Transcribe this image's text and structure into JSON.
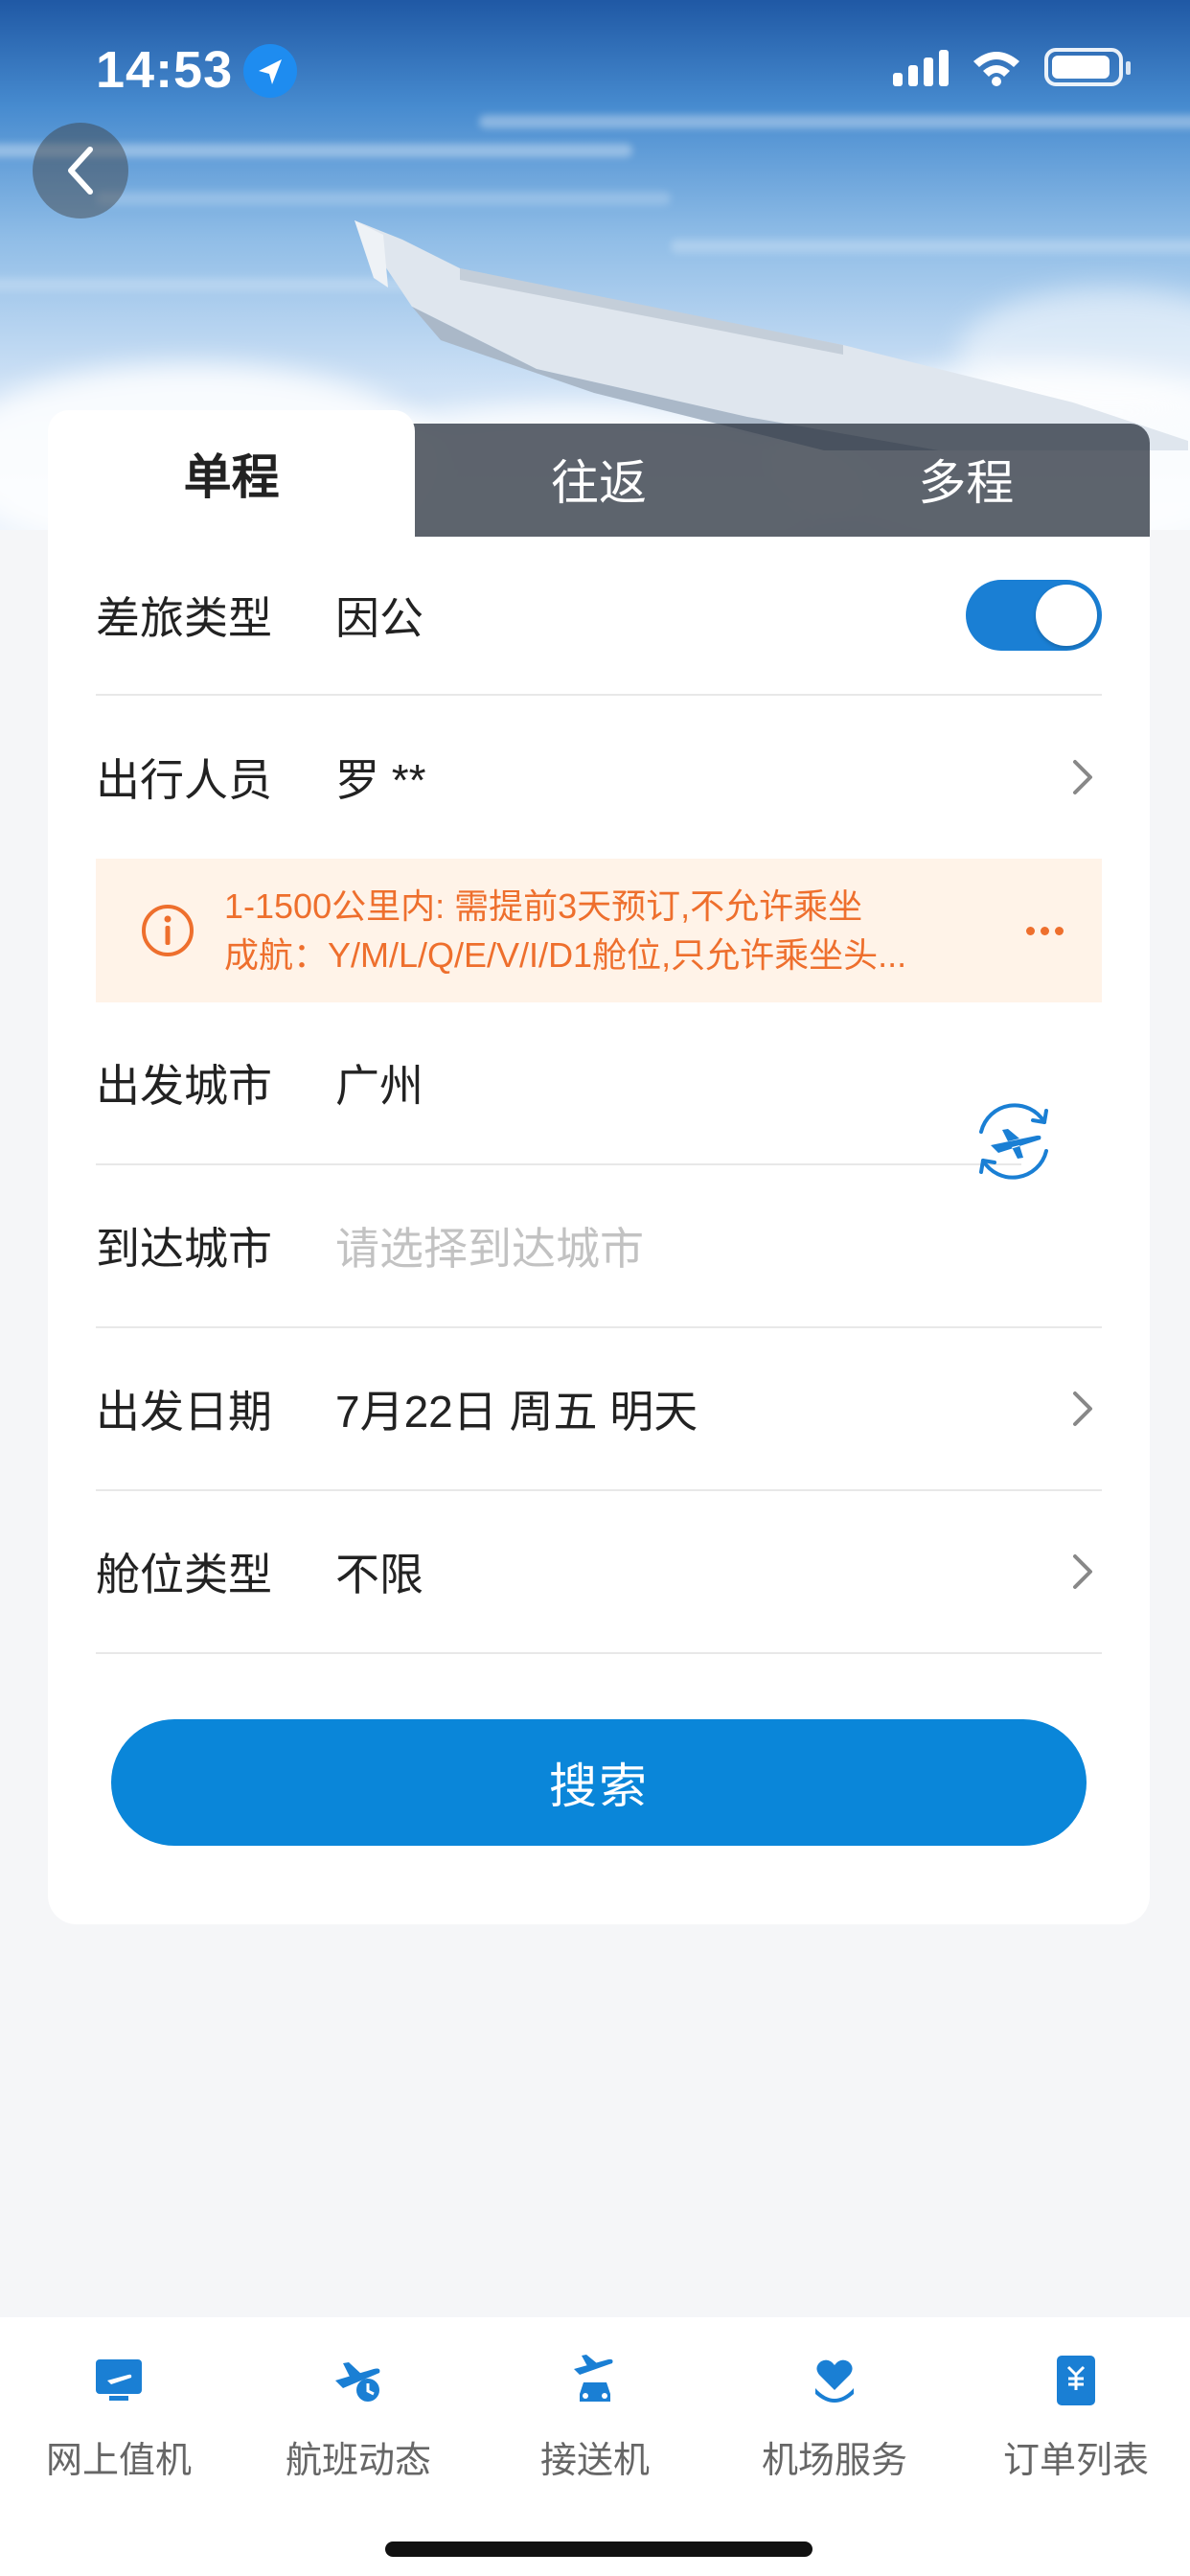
{
  "status_bar": {
    "time": "14:53"
  },
  "header": {
    "back_icon": "chevron-left-icon"
  },
  "tabs": [
    {
      "label": "单程",
      "active": true
    },
    {
      "label": "往返",
      "active": false
    },
    {
      "label": "多程",
      "active": false
    }
  ],
  "form": {
    "travel_type": {
      "label": "差旅类型",
      "value": "因公",
      "toggle_on": true
    },
    "traveler": {
      "label": "出行人员",
      "value": "罗 **"
    },
    "notice": {
      "line1": "1-1500公里内: 需提前3天预订,不允许乘坐",
      "line2": "成航：Y/M/L/Q/E/V/I/D1舱位,只允许乘坐头..."
    },
    "departure_city": {
      "label": "出发城市",
      "value": "广州"
    },
    "arrival_city": {
      "label": "到达城市",
      "placeholder": "请选择到达城市"
    },
    "departure_date": {
      "label": "出发日期",
      "value": "7月22日 周五 明天"
    },
    "cabin_type": {
      "label": "舱位类型",
      "value": "不限"
    }
  },
  "search_button": {
    "label": "搜索"
  },
  "bottom_nav": [
    {
      "label": "网上值机",
      "icon": "checkin-monitor-icon"
    },
    {
      "label": "航班动态",
      "icon": "flight-status-icon"
    },
    {
      "label": "接送机",
      "icon": "airport-transfer-icon"
    },
    {
      "label": "机场服务",
      "icon": "airport-service-heart-icon"
    },
    {
      "label": "订单列表",
      "icon": "order-list-icon"
    }
  ],
  "colors": {
    "primary": "#0a86d9",
    "notice_text": "#ee6f2d",
    "notice_bg": "#fff3e8"
  }
}
